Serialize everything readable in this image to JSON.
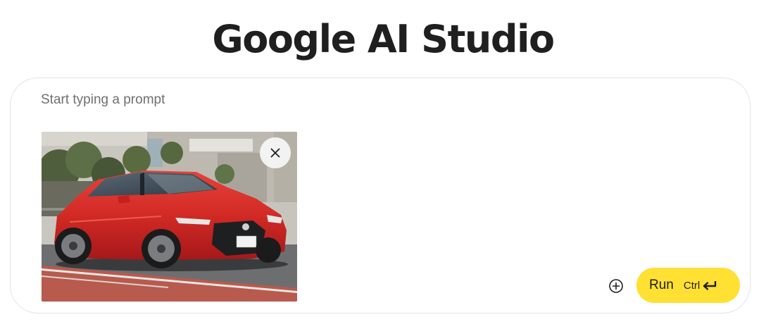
{
  "app": {
    "title": "Google AI Studio"
  },
  "prompt": {
    "placeholder": "Start typing a prompt",
    "value": ""
  },
  "attachment": {
    "type": "image",
    "subject": "red car photo",
    "remove_icon": "close-icon"
  },
  "toolbar": {
    "add_icon": "add-circle-icon",
    "run_label": "Run",
    "run_shortcut": "Ctrl",
    "enter_icon": "enter-icon"
  },
  "colors": {
    "run_button": "#ffe033",
    "text": "#1f1f1f",
    "placeholder": "#6f6f6f",
    "box_border": "#e3e3e3"
  }
}
